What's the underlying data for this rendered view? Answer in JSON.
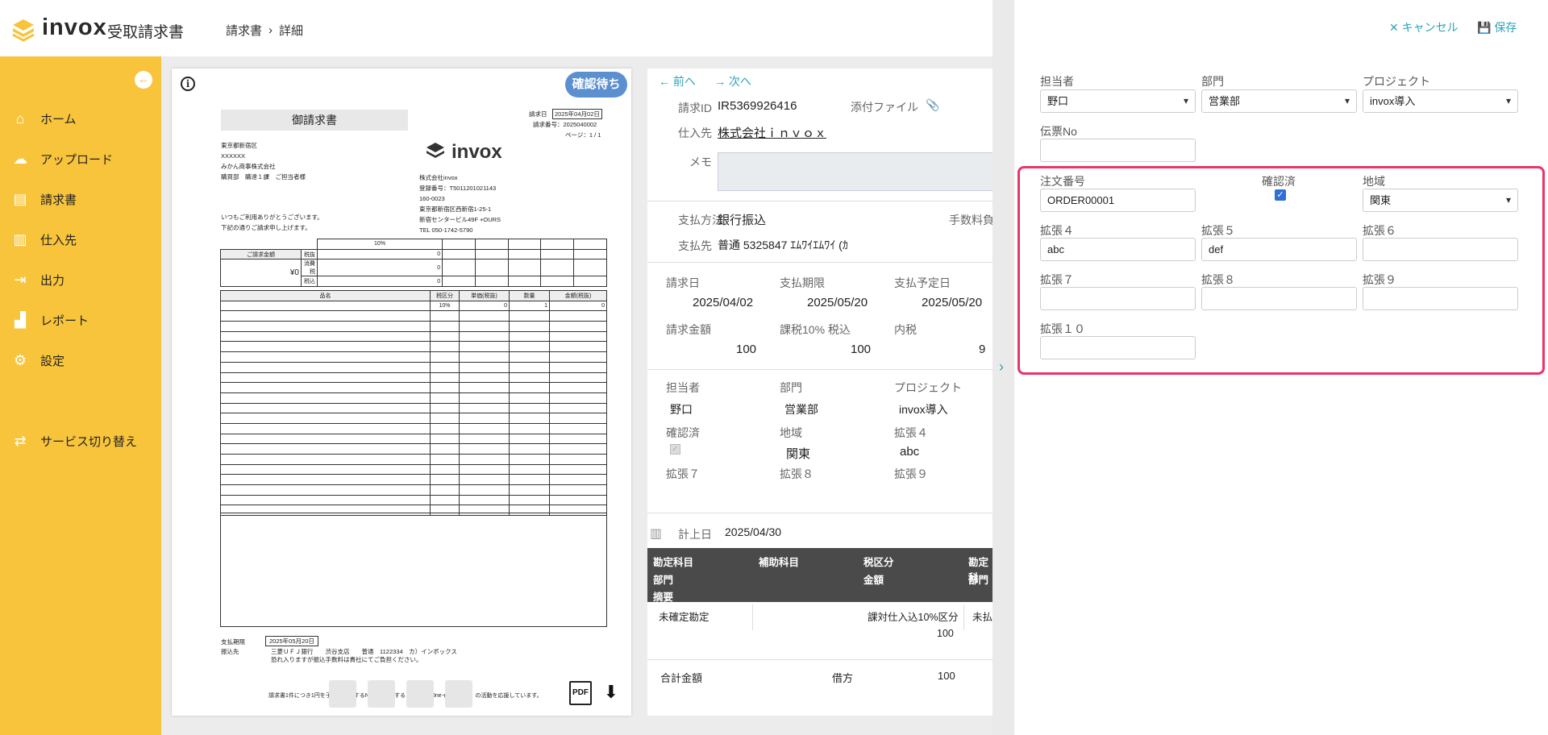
{
  "app": {
    "logo": "invox",
    "logo_sub": "受取請求書"
  },
  "breadcrumb": {
    "root": "請求書",
    "separator": "›",
    "current": "詳細"
  },
  "sidebar": {
    "items": [
      {
        "label": "ホーム",
        "icon": "home-icon"
      },
      {
        "label": "アップロード",
        "icon": "cloud-upload-icon"
      },
      {
        "label": "請求書",
        "icon": "document-icon"
      },
      {
        "label": "仕入先",
        "icon": "building-icon"
      },
      {
        "label": "出力",
        "icon": "export-icon"
      },
      {
        "label": "レポート",
        "icon": "chart-icon"
      },
      {
        "label": "設定",
        "icon": "gear-icon"
      },
      {
        "label": "サービス切り替え",
        "icon": "switch-icon"
      }
    ]
  },
  "doc": {
    "status": "確認待ち",
    "title": "御請求書",
    "issue_label": "請求日",
    "issue_date": "2025年04月02日",
    "invoice_no": "請求番号：2025040002",
    "page": "ページ：1 / 1",
    "to_lines": [
      "東京都新宿区",
      "XXXXXX",
      "みかん商事株式会社",
      "購買部　購達１課　ご担当者様"
    ],
    "greeting": [
      "いつもご利用ありがとうございます。",
      "下記の通りご請求申し上げます。"
    ],
    "company": [
      "株式会社invox",
      "登録番号：T5011201021143",
      "160-0023",
      "東京都新宿区西新宿1-25-1",
      "新宿センタービル49F +OURS",
      "TEL 050-1742-5790"
    ],
    "logo": "invox",
    "summary_label": "ご請求金額",
    "summary_amount": "¥0",
    "rate": "10%",
    "sum_rows": [
      {
        "k": "税抜",
        "v": "0"
      },
      {
        "k": "消費税",
        "v": "0"
      },
      {
        "k": "税込",
        "v": "0"
      }
    ],
    "item_headers": [
      "品名",
      "税区分",
      "単価(税抜)",
      "数量",
      "金額(税抜)"
    ],
    "item_row": [
      "",
      "10%",
      "0",
      "1",
      "0"
    ],
    "pay_due_label": "支払期限",
    "pay_due": "2025年05月20日",
    "bank_label": "振込先",
    "bank": "三菱ＵＦＪ銀行　　渋谷支店　　普通　1122334　カ）インボックス",
    "bank_note": "恐れ入りますが振込手数料は貴社にてご負担ください。",
    "footer": "請求書1件につき1円を子どもに関するNPOに寄付する「One by Oneインボイス」の活動を応援しています。",
    "pdf": "PDF"
  },
  "details": {
    "prev": "前へ",
    "next": "次へ",
    "id_label": "請求ID",
    "id": "IR5369926416",
    "attach_label": "添付ファイル",
    "vendor_label": "仕入先",
    "vendor": "株式会社ｉｎｖｏｘ",
    "memo_label": "メモ",
    "paymethod_label": "支払方法",
    "paymethod": "銀行振込",
    "fee_label": "手数料負",
    "payto_label": "支払先",
    "payto": "普通 5325847 ｴﾑﾜｲｴﾑﾜｲ (ｶ",
    "inv_date_label": "請求日",
    "inv_date": "2025/04/02",
    "due_label": "支払期限",
    "due": "2025/05/20",
    "sched_label": "支払予定日",
    "sched": "2025/05/20",
    "amt_label": "請求金額",
    "amt": "100",
    "tax_label": "課税10% 税込",
    "tax": "100",
    "intax_label": "内税",
    "intax": "9",
    "person_label": "担当者",
    "person": "野口",
    "dept_label": "部門",
    "dept": "営業部",
    "proj_label": "プロジェクト",
    "proj": "invox導入",
    "confirmed_label": "確認済",
    "region_label": "地域",
    "region": "関東",
    "ext4_label": "拡張４",
    "ext4": "abc",
    "ext7_label": "拡張７",
    "ext8_label": "拡張８",
    "ext9_label": "拡張９",
    "post_label": "計上日",
    "post_date": "2025/04/30",
    "j_headers": [
      "勘定科目",
      "補助科目",
      "税区分",
      "勘定科",
      "部門",
      "金額",
      "部門",
      "摘要"
    ],
    "j_account": "未確定勘定",
    "j_tax": "課対仕入込10%区分",
    "j_amount": "100",
    "j_credit": "未払",
    "total_label": "合計金額",
    "debit_label": "借方",
    "total": "100"
  },
  "panel": {
    "cancel": "キャンセル",
    "save": "保存",
    "fields": {
      "person": {
        "label": "担当者",
        "value": "野口"
      },
      "dept": {
        "label": "部門",
        "value": "営業部"
      },
      "project": {
        "label": "プロジェクト",
        "value": "invox導入"
      },
      "slip": {
        "label": "伝票No",
        "value": ""
      },
      "order": {
        "label": "注文番号",
        "value": "ORDER00001"
      },
      "confirmed": {
        "label": "確認済"
      },
      "region": {
        "label": "地域",
        "value": "関東"
      },
      "ext4": {
        "label": "拡張４",
        "value": "abc"
      },
      "ext5": {
        "label": "拡張５",
        "value": "def"
      },
      "ext6": {
        "label": "拡張６",
        "value": ""
      },
      "ext7": {
        "label": "拡張７",
        "value": ""
      },
      "ext8": {
        "label": "拡張８",
        "value": ""
      },
      "ext9": {
        "label": "拡張９",
        "value": ""
      },
      "ext10": {
        "label": "拡張１０",
        "value": ""
      }
    }
  }
}
